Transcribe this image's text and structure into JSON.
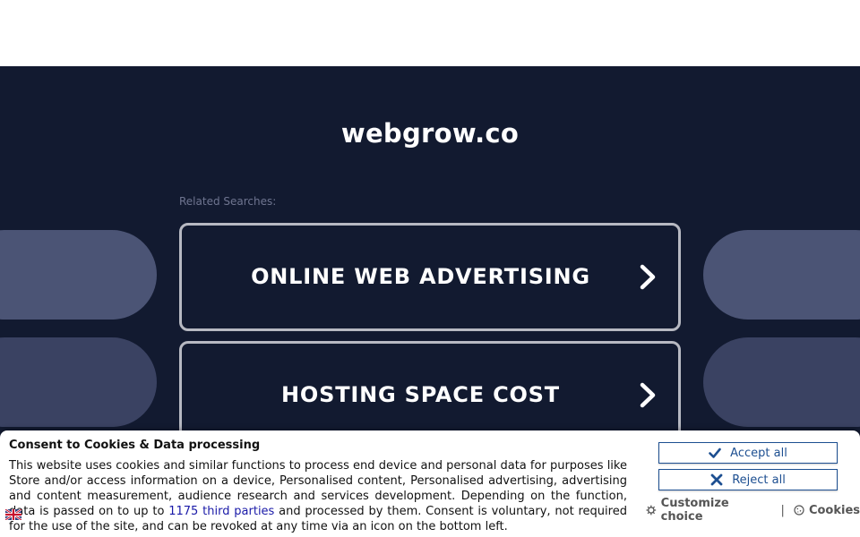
{
  "page": {
    "domain": "webgrow.co",
    "related_label": "Related Searches:"
  },
  "cards": [
    {
      "label": "ONLINE WEB ADVERTISING",
      "icon": "chevron-right-icon"
    },
    {
      "label": "HOSTING SPACE COST",
      "icon": "chevron-right-icon"
    }
  ],
  "consent": {
    "title": "Consent to Cookies & Data processing",
    "text_before": "This website uses cookies and similar functions to process end device and personal data for purposes like Store and/or access information on a device, Personalised content, Personalised advertising, advertising and content measurement, audience research and services development. Depending on the function, data is passed on to up to ",
    "link_text": "1175 third parties",
    "text_after": " and processed by them. Consent is voluntary, not required for the use of the site, and can be revoked at any time via an icon on the bottom left.",
    "accept_label": "Accept all",
    "reject_label": "Reject all",
    "customize_label": "Customize choice",
    "separator": "|",
    "cookies_label": "Cookies"
  },
  "colors": {
    "background": "#121a30",
    "card_border": "#b7b9c2",
    "button_blue": "#1d4f91",
    "link": "#1a1aa8"
  }
}
